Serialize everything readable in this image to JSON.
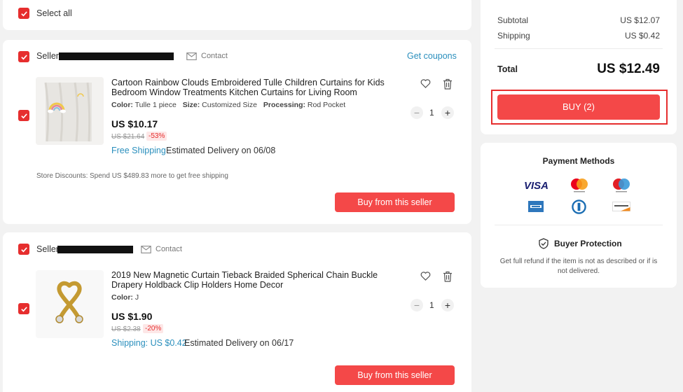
{
  "select_all": {
    "label": "Select all"
  },
  "stores": [
    {
      "seller_label": "Seller:",
      "contact_label": "Contact",
      "coupons_label": "Get coupons",
      "item": {
        "title_line1": "Cartoon Rainbow Clouds Embroidered Tulle Children Curtains for Kids",
        "title_line2": "Bedroom Window Treatments Kitchen Curtains for Living Room",
        "attrs": [
          {
            "key": "Color:",
            "value": "Tulle 1 piece"
          },
          {
            "key": "Size:",
            "value": "Customized Size"
          },
          {
            "key": "Processing:",
            "value": "Rod Pocket"
          }
        ],
        "price": "US $10.17",
        "old_price": "US $21.64",
        "discount": "-53%",
        "shipping": "Free Shipping",
        "delivery": "Estimated Delivery on 06/08",
        "quantity": "1",
        "minus": "−",
        "plus": "+"
      },
      "store_discount_label": "Store Discounts:",
      "store_discount_text": "Spend US $489.83 more to get free shipping",
      "buy_label": "Buy from this seller"
    },
    {
      "seller_label": "Seller:",
      "contact_label": "Contact",
      "item": {
        "title_line1": "2019 New Magnetic Curtain Tieback Braided Spherical Chain Buckle",
        "title_line2": "Drapery Holdback Clip Holders Home Decor",
        "attrs": [
          {
            "key": "Color:",
            "value": "J"
          }
        ],
        "price": "US $1.90",
        "old_price": "US $2.38",
        "discount": "-20%",
        "shipping": "Shipping: US $0.42",
        "delivery": "Estimated Delivery on 06/17",
        "quantity": "1",
        "minus": "−",
        "plus": "+"
      },
      "buy_label": "Buy from this seller"
    }
  ],
  "summary": {
    "subtotal_label": "Subtotal",
    "subtotal_value": "US $12.07",
    "shipping_label": "Shipping",
    "shipping_value": "US $0.42",
    "total_label": "Total",
    "total_value": "US $12.49",
    "buy_label": "BUY (2)"
  },
  "payment": {
    "title": "Payment Methods",
    "visa_label": "VISA",
    "protection_title": "Buyer Protection",
    "protection_line1": "Get full refund if the item is not as described or if is",
    "protection_line2": "not delivered."
  },
  "colors": {
    "accent": "#e62e2e",
    "button": "#f44848",
    "link": "#2a8fbd",
    "discount_bg": "#fde7e7"
  }
}
